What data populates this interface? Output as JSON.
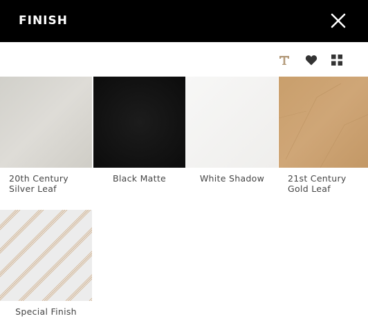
{
  "header": {
    "title": "FINISH"
  },
  "toolbar": {
    "icons": [
      "text-icon",
      "heart-icon",
      "grid-icon"
    ],
    "text_icon_color": "#b39a7a"
  },
  "finishes": [
    {
      "label": "20th Century\nSilver Leaf",
      "color": "#d9d8d3"
    },
    {
      "label": "Black Matte",
      "color": "#151515"
    },
    {
      "label": "White Shadow",
      "color": "#f5f4f3"
    },
    {
      "label": "21st Century\nGold Leaf",
      "color": "#c8a071"
    },
    {
      "label": "Special Finish",
      "color": "#ececec",
      "stripe_color": "#d4b797"
    }
  ]
}
